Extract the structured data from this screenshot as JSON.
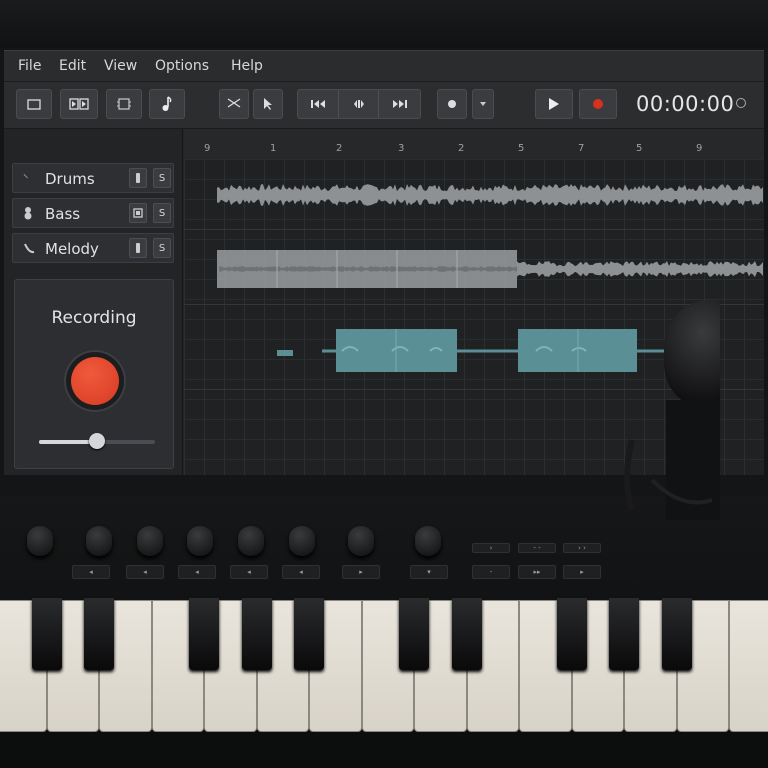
{
  "menu": {
    "file": "File",
    "edit": "Edit",
    "view": "View",
    "options": "Options",
    "help": "Help"
  },
  "toolbar": {
    "timecode": "00:00:00",
    "record_color": "#d7311f"
  },
  "tracks": [
    {
      "name": "Drums",
      "icon": "drum-icon",
      "mute": "░",
      "solo": "S"
    },
    {
      "name": "Bass",
      "icon": "bass-icon",
      "mute": "▣",
      "solo": "S"
    },
    {
      "name": "Melody",
      "icon": "melody-icon",
      "mute": "░",
      "solo": "S"
    }
  ],
  "recording_panel": {
    "title": "Recording",
    "level": 0.5
  },
  "ruler": {
    "labels": [
      "9",
      "1",
      "2",
      "3",
      "2",
      "5",
      "7",
      "5",
      "9"
    ]
  },
  "colors": {
    "accent": "#e14b30",
    "clip": "#5a8f96",
    "audio": "#8e9194"
  }
}
